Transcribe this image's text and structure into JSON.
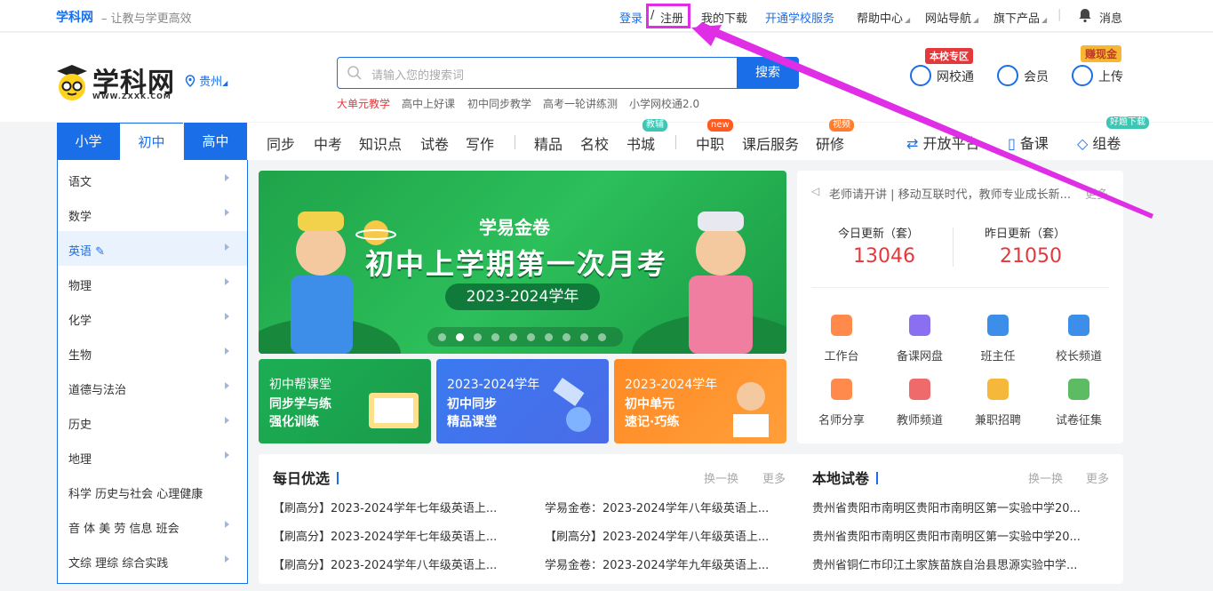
{
  "topbar": {
    "brand": "学科网",
    "slogan": "– 让教与学更高效",
    "login": "登录",
    "slash": "/",
    "register": "注册",
    "downloads": "我的下载",
    "school_service": "开通学校服务",
    "help": "帮助中心",
    "site_nav": "网站导航",
    "products": "旗下产品",
    "divider": "|",
    "messages": "消息"
  },
  "header": {
    "logo_text": "学科网",
    "logo_url": "WWW.ZXXK.COM",
    "location": "贵州",
    "search_placeholder": "请输入您的搜索词",
    "search_button": "搜索",
    "hot": [
      "大单元教学",
      "高中上好课",
      "初中同步教学",
      "高考一轮讲练测",
      "小学网校通2.0"
    ],
    "school_tag": "本校专区",
    "school_link": "网校通",
    "member": "会员",
    "cash_tag": "赚现金",
    "upload": "上传"
  },
  "grades": [
    "小学",
    "初中",
    "高中"
  ],
  "nav": {
    "items": [
      "同步",
      "中考",
      "知识点",
      "试卷",
      "写作",
      "精品",
      "名校",
      "书城",
      "中职",
      "课后服务",
      "研修"
    ],
    "badges": {
      "bookstore": "教辅",
      "vocational": "new",
      "training": "视频"
    },
    "right": [
      "开放平台",
      "备课",
      "组卷"
    ],
    "right_badge": "好题下载"
  },
  "sidebar": {
    "items": [
      "语文",
      "数学",
      "英语",
      "物理",
      "化学",
      "生物",
      "道德与法治",
      "历史",
      "地理",
      "科学  历史与社会  心理健康",
      "音 体 美 劳  信息  班会",
      "文综  理综  综合实践"
    ]
  },
  "banner": {
    "subtitle": "学易金卷",
    "title": "初中上学期第一次月考",
    "year": "2023-2024学年"
  },
  "cards": [
    {
      "lines": [
        "初中帮课堂",
        "同步学与练",
        "强化训练"
      ]
    },
    {
      "lines": [
        "2023-2024学年",
        "初中同步",
        "精品课堂"
      ]
    },
    {
      "lines": [
        "2023-2024学年",
        "初中单元",
        "速记·巧练"
      ]
    }
  ],
  "panel": {
    "notice": "老师请开讲 | 移动互联时代，教师专业成长新...",
    "more": "更多",
    "today_label": "今日更新（套）",
    "today_value": "13046",
    "yesterday_label": "昨日更新（套）",
    "yesterday_value": "21050",
    "tools": [
      "工作台",
      "备课网盘",
      "班主任",
      "校长频道",
      "名师分享",
      "教师频道",
      "兼职招聘",
      "试卷征集"
    ]
  },
  "daily": {
    "title": "每日优选",
    "swap": "换一换",
    "more": "更多",
    "left": [
      "【刷高分】2023-2024学年七年级英语上...",
      "【刷高分】2023-2024学年七年级英语上...",
      "【刷高分】2023-2024学年八年级英语上..."
    ],
    "right": [
      "学易金卷：2023-2024学年八年级英语上...",
      "【刷高分】2023-2024学年八年级英语上...",
      "学易金卷：2023-2024学年九年级英语上..."
    ]
  },
  "local": {
    "title": "本地试卷",
    "swap": "换一换",
    "more": "更多",
    "items": [
      "贵州省贵阳市南明区贵阳市南明区第一实验中学20...",
      "贵州省贵阳市南明区贵阳市南明区第一实验中学20...",
      "贵州省铜仁市印江土家族苗族自治县思源实验中学..."
    ]
  },
  "colors": {
    "brand": "#1a6fe8",
    "highlight": "#e02ee6",
    "accent_red": "#e4393c"
  }
}
